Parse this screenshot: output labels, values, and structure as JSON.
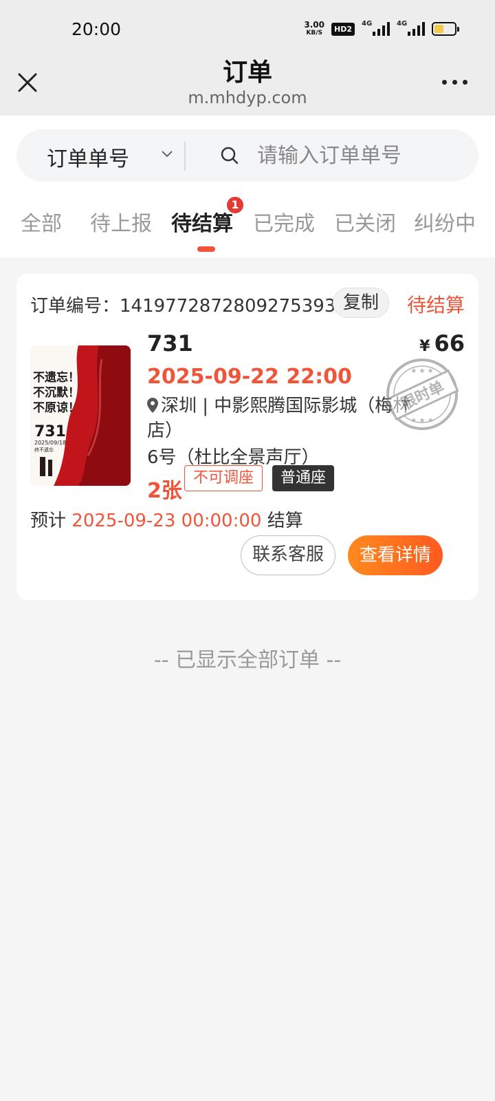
{
  "status_bar": {
    "time": "20:00",
    "net_speed": "3.00",
    "net_speed_unit": "KB/S",
    "hd_badge": "HD2",
    "signal1_label": "4G",
    "signal2_label": "4G",
    "battery_level": 0.45,
    "battery_color": "#f2c94c"
  },
  "header": {
    "title": "订单",
    "url": "m.mhdyp.com",
    "close_icon": "close-icon",
    "more_icon": "more-icon"
  },
  "search": {
    "selector_label": "订单单号",
    "placeholder": "请输入订单单号"
  },
  "tabs": [
    {
      "label": "全部"
    },
    {
      "label": "待上报"
    },
    {
      "label": "待结算",
      "active": true,
      "badge": "1"
    },
    {
      "label": "已完成"
    },
    {
      "label": "已关闭"
    },
    {
      "label": "纠纷中"
    }
  ],
  "order": {
    "number_label": "订单编号：",
    "number": "1419772872809275393",
    "copy_label": "复制",
    "status": "待结算",
    "movie_title": "731",
    "price_currency": "¥",
    "price": "66",
    "showtime": "2025-09-22 22:00",
    "cinema": "深圳 | 中影熙腾国际影城（梅林店）",
    "hall": "6号（杜比全景声厅）",
    "ticket_count": "2张",
    "tag_seat_adjust": "不可调座",
    "tag_seat_type": "普通座",
    "stamp_text": "限时单",
    "settle_prefix": "预计",
    "settle_date": "2025-09-23 00:00:00",
    "settle_suffix": "结算",
    "contact_label": "联系客服",
    "detail_label": "查看详情",
    "poster": {
      "slogan_1": "不遗忘！",
      "slogan_2": "不沉默！",
      "slogan_3": "不原谅！",
      "title": "731",
      "release": "2025/09/18",
      "release_note": "终不遗忘"
    }
  },
  "footer": {
    "end_text": "-- 已显示全部订单 --"
  },
  "colors": {
    "accent": "#f0553a",
    "button_gradient_start": "#ff8a1f",
    "button_gradient_end": "#ff5a1f"
  }
}
